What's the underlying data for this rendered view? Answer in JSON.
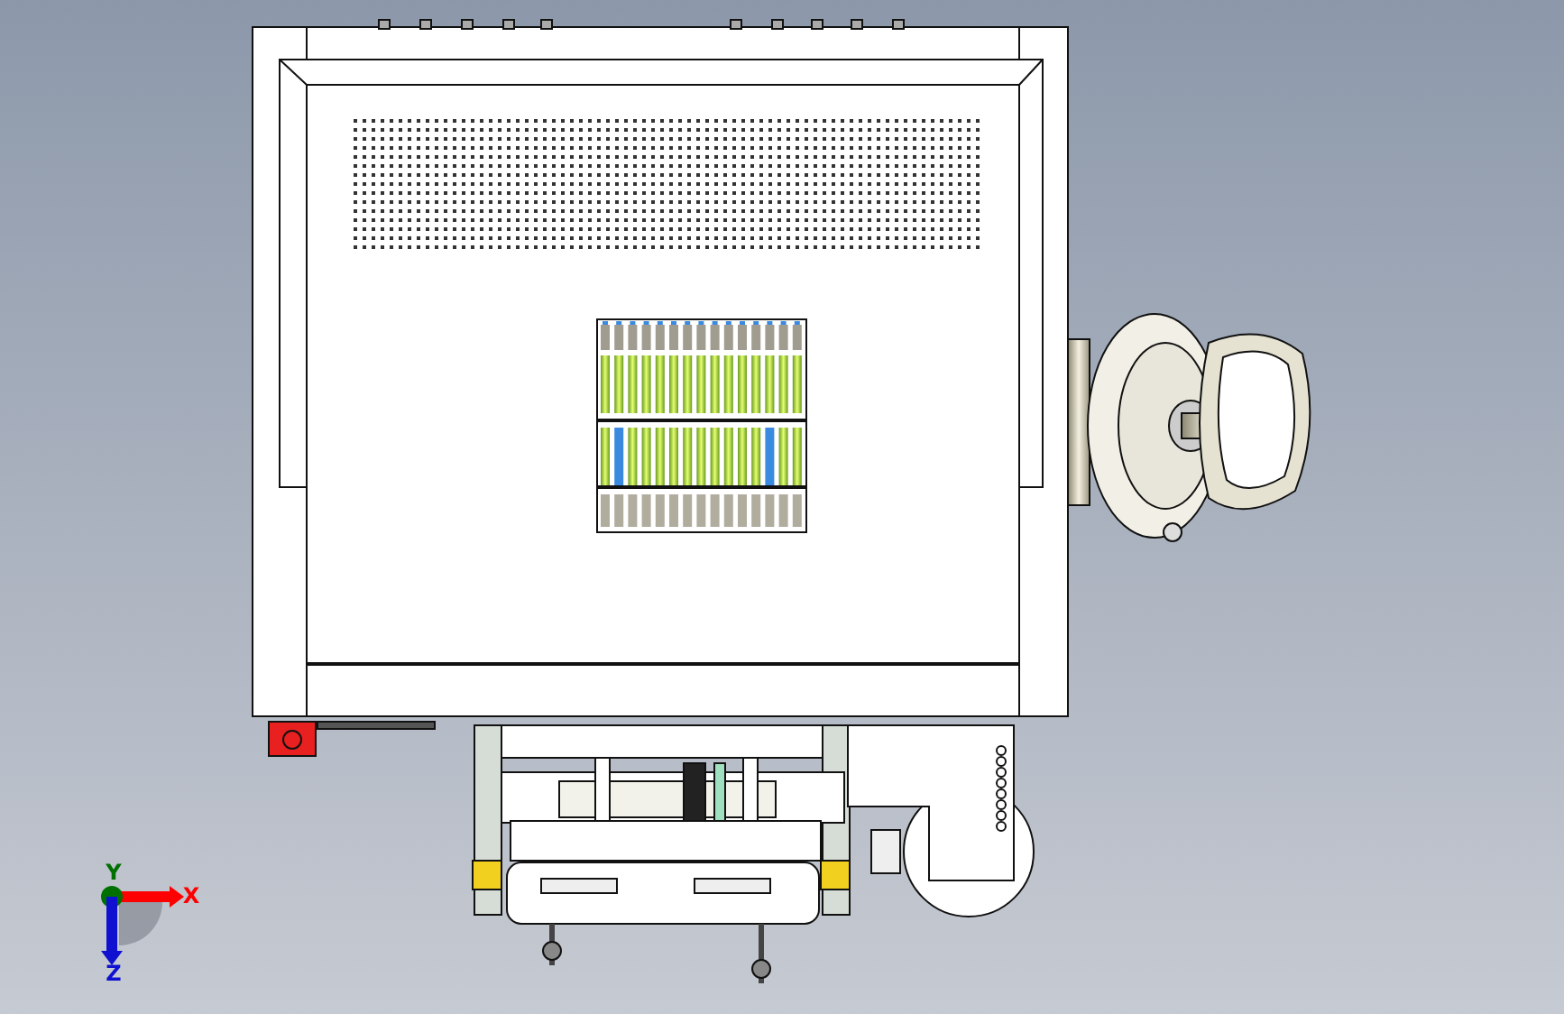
{
  "viewport": {
    "triad": [
      {
        "label": "X",
        "kind": "arrow",
        "color": "#ff0000"
      },
      {
        "label": "Y",
        "kind": "point",
        "color": "#007000"
      },
      {
        "label": "Z",
        "kind": "arrow",
        "color": "#1010d0"
      }
    ]
  }
}
